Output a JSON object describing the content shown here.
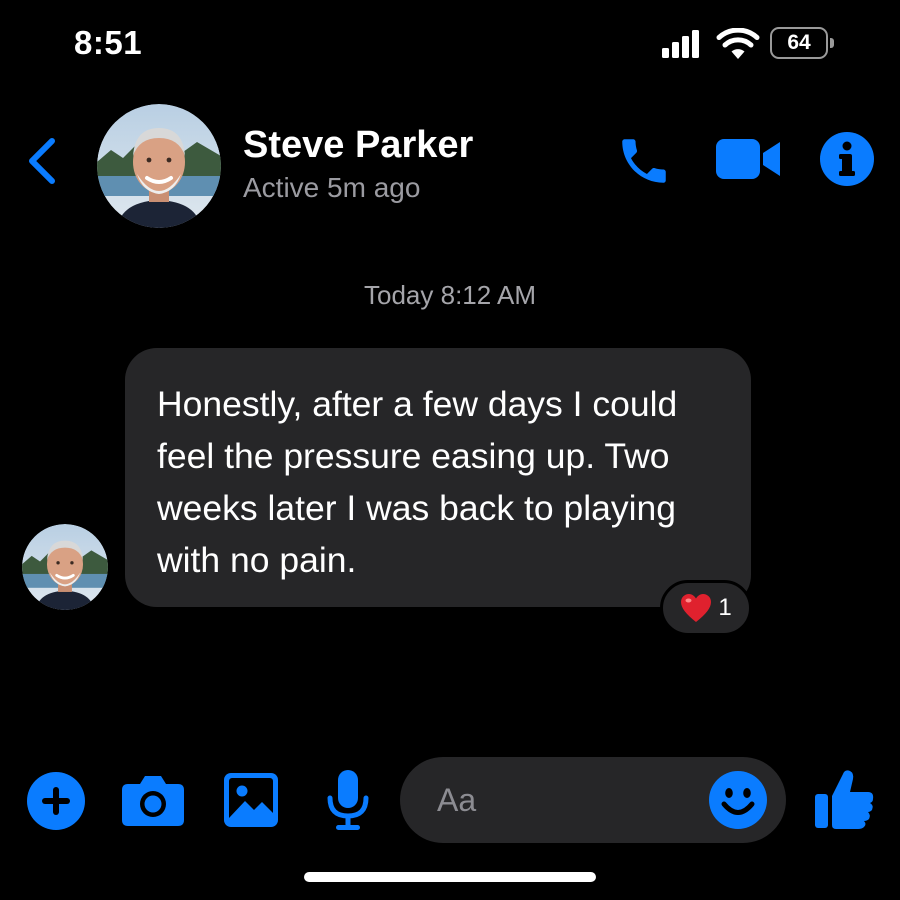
{
  "status_bar": {
    "time": "8:51",
    "battery": "64"
  },
  "header": {
    "contact_name": "Steve Parker",
    "contact_status": "Active 5m ago"
  },
  "conversation": {
    "timestamp": "Today 8:12 AM",
    "messages": [
      {
        "text": "Honestly, after a few days I could feel the pressure easing up. Two weeks later I was back to playing with no pain.",
        "reaction_emoji": "❤️",
        "reaction_count": "1"
      }
    ]
  },
  "composer": {
    "placeholder": "Aa"
  },
  "icons": {
    "back": "chevron-left-icon",
    "call": "phone-icon",
    "video": "video-camera-icon",
    "info": "info-icon",
    "add": "plus-icon",
    "camera": "camera-icon",
    "gallery": "image-icon",
    "voice": "microphone-icon",
    "emoji": "smiley-icon",
    "like": "thumbs-up-icon"
  },
  "colors": {
    "accent": "#0a7cff",
    "background": "#000000",
    "bubble": "#262628",
    "secondary_text": "#9b9ba1"
  }
}
